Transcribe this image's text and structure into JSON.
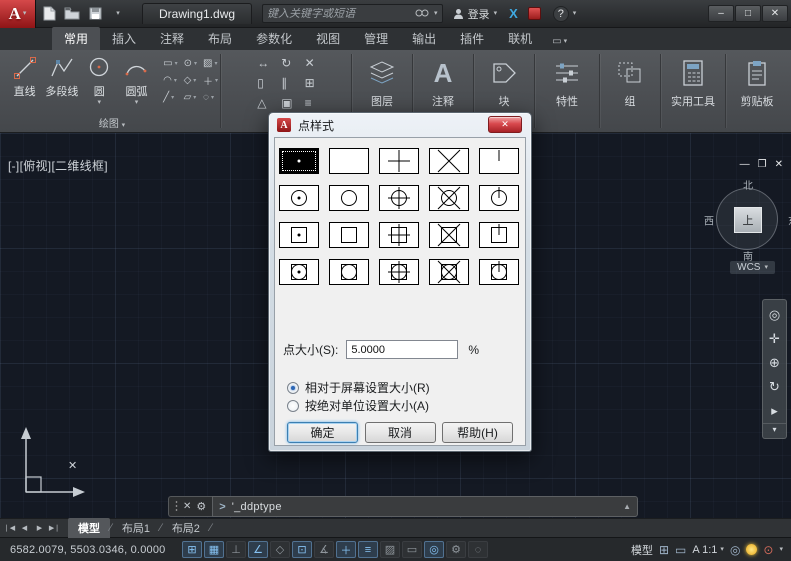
{
  "titlebar": {
    "doc_title": "Drawing1.dwg",
    "search_placeholder": "键入关键字或短语",
    "signin_label": "登录",
    "exchange_label": "X",
    "help_label": "?"
  },
  "ribbon": {
    "tabs": [
      "常用",
      "插入",
      "注释",
      "布局",
      "参数化",
      "视图",
      "管理",
      "输出",
      "插件",
      "联机"
    ],
    "draw_tools": [
      "直线",
      "多段线",
      "圆",
      "圆弧"
    ],
    "draw_panel_label": "绘图",
    "panels": [
      "图层",
      "注释",
      "块",
      "特性",
      "组",
      "实用工具",
      "剪贴板"
    ]
  },
  "viewport": {
    "controls": [
      "[-]",
      "[俯视]",
      "[二维线框]"
    ]
  },
  "viewcube": {
    "north": "北",
    "west": "西",
    "east": "东",
    "south": "南",
    "top": "上",
    "wcs": "WCS"
  },
  "dialog": {
    "title": "点样式",
    "size_label": "点大小(S):",
    "size_value": "5.0000",
    "size_unit": "%",
    "radio_relative": "相对于屏幕设置大小(R)",
    "radio_absolute": "按绝对单位设置大小(A)",
    "ok_label": "确定",
    "cancel_label": "取消",
    "help_label": "帮助(H)"
  },
  "command": {
    "prompt": ">",
    "text": "'_ddptype"
  },
  "layout_tabs": [
    "模型",
    "布局1",
    "布局2"
  ],
  "statusbar": {
    "coordinates": "6582.0079, 5503.0346, 0.0000",
    "model_label": "模型",
    "annotation_scale": "A 1:1"
  }
}
